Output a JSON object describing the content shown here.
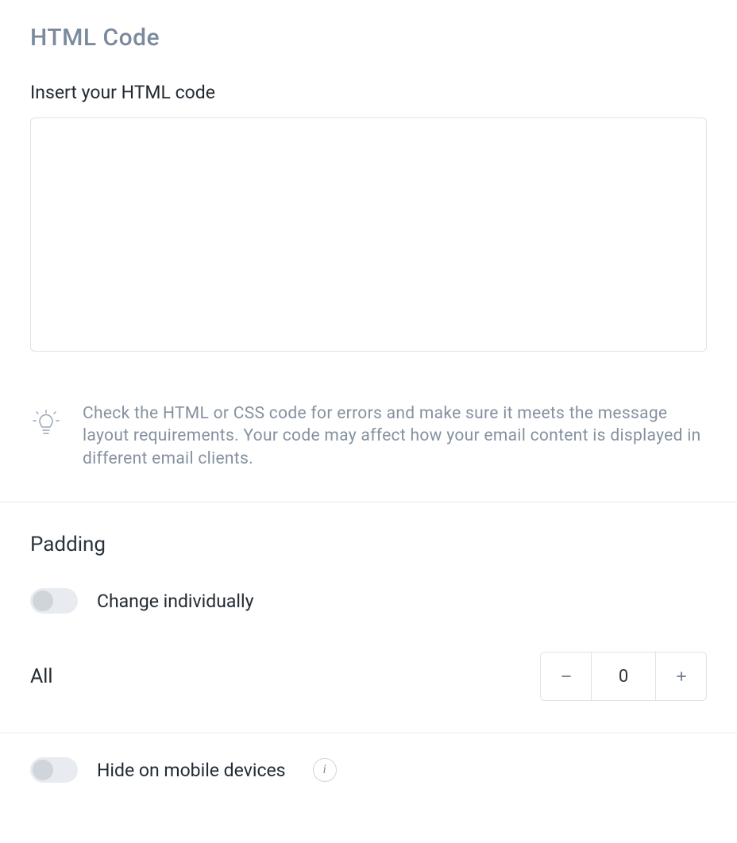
{
  "html_code": {
    "section_title": "HTML Code",
    "field_label": "Insert your HTML code",
    "textarea_value": "",
    "hint_text": "Check the HTML or CSS code for errors and make sure it meets the message layout requirements. Your code may affect how your email content is displayed in different email clients."
  },
  "padding": {
    "section_title": "Padding",
    "change_individually_label": "Change individually",
    "change_individually_on": false,
    "all_label": "All",
    "all_value": "0"
  },
  "hide_mobile": {
    "label": "Hide on mobile devices",
    "on": false
  }
}
